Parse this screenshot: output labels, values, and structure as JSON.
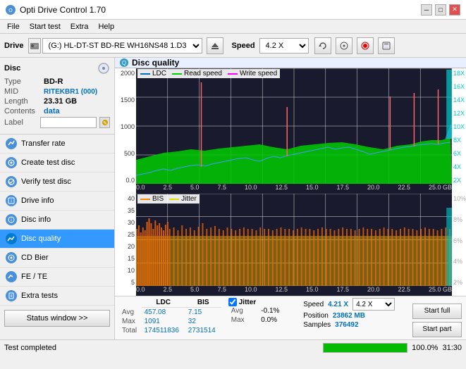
{
  "titleBar": {
    "title": "Opti Drive Control 1.70",
    "minimizeBtn": "─",
    "maximizeBtn": "□",
    "closeBtn": "✕"
  },
  "menuBar": {
    "items": [
      "File",
      "Start test",
      "Extra",
      "Help"
    ]
  },
  "driveToolbar": {
    "label": "Drive",
    "driveValue": "(G:)  HL-DT-ST BD-RE  WH16NS48 1.D3",
    "speedLabel": "Speed",
    "speedValue": "4.2 X"
  },
  "sidebar": {
    "discSection": {
      "title": "Disc",
      "fields": [
        {
          "label": "Type",
          "value": "BD-R"
        },
        {
          "label": "MID",
          "value": "RITEKBR1 (000)"
        },
        {
          "label": "Length",
          "value": "23.31 GB"
        },
        {
          "label": "Contents",
          "value": "data"
        },
        {
          "label": "Label",
          "value": ""
        }
      ]
    },
    "menuItems": [
      {
        "label": "Transfer rate",
        "active": false
      },
      {
        "label": "Create test disc",
        "active": false
      },
      {
        "label": "Verify test disc",
        "active": false
      },
      {
        "label": "Drive info",
        "active": false
      },
      {
        "label": "Disc info",
        "active": false
      },
      {
        "label": "Disc quality",
        "active": true
      },
      {
        "label": "CD Bier",
        "active": false
      },
      {
        "label": "FE / TE",
        "active": false
      },
      {
        "label": "Extra tests",
        "active": false
      }
    ],
    "statusBtn": "Status window >>"
  },
  "discQuality": {
    "title": "Disc quality",
    "legend": {
      "ldc": "LDC",
      "readSpeed": "Read speed",
      "writeSpeed": "Write speed",
      "bis": "BIS",
      "jitter": "Jitter"
    },
    "topChart": {
      "yAxisLeft": [
        "2000",
        "1500",
        "1000",
        "500",
        "0.0"
      ],
      "yAxisRight": [
        "18X",
        "16X",
        "14X",
        "12X",
        "10X",
        "8X",
        "6X",
        "4X",
        "2X"
      ],
      "xAxis": [
        "0.0",
        "2.5",
        "5.0",
        "7.5",
        "10.0",
        "12.5",
        "15.0",
        "17.5",
        "20.0",
        "22.5",
        "25.0 GB"
      ]
    },
    "bottomChart": {
      "yAxisLeft": [
        "40",
        "35",
        "30",
        "25",
        "20",
        "15",
        "10",
        "5"
      ],
      "yAxisRight": [
        "10%",
        "8%",
        "6%",
        "4%",
        "2%"
      ],
      "xAxis": [
        "0.0",
        "2.5",
        "5.0",
        "7.5",
        "10.0",
        "12.5",
        "15.0",
        "17.5",
        "20.0",
        "22.5",
        "25.0 GB"
      ]
    }
  },
  "stats": {
    "headers": [
      "LDC",
      "BIS"
    ],
    "rows": [
      {
        "label": "Avg",
        "ldc": "457.08",
        "bis": "7.15"
      },
      {
        "label": "Max",
        "ldc": "1091",
        "bis": "32"
      },
      {
        "label": "Total",
        "ldc": "174511836",
        "bis": "2731514"
      }
    ],
    "jitterChecked": true,
    "jitterLabel": "Jitter",
    "jitterRows": [
      {
        "label": "Avg",
        "val": "-0.1%"
      },
      {
        "label": "Max",
        "val": "0.0%"
      },
      {
        "label": "",
        "val": ""
      }
    ],
    "speed": {
      "label": "Speed",
      "value": "4.21 X",
      "selectValue": "4.2 X"
    },
    "position": {
      "label": "Position",
      "value": "23862 MB"
    },
    "samples": {
      "label": "Samples",
      "value": "376492"
    },
    "buttons": {
      "startFull": "Start full",
      "startPart": "Start part"
    }
  },
  "statusBar": {
    "text": "Test completed",
    "progress": 100,
    "progressLabel": "100.0%",
    "time": "31:30"
  }
}
